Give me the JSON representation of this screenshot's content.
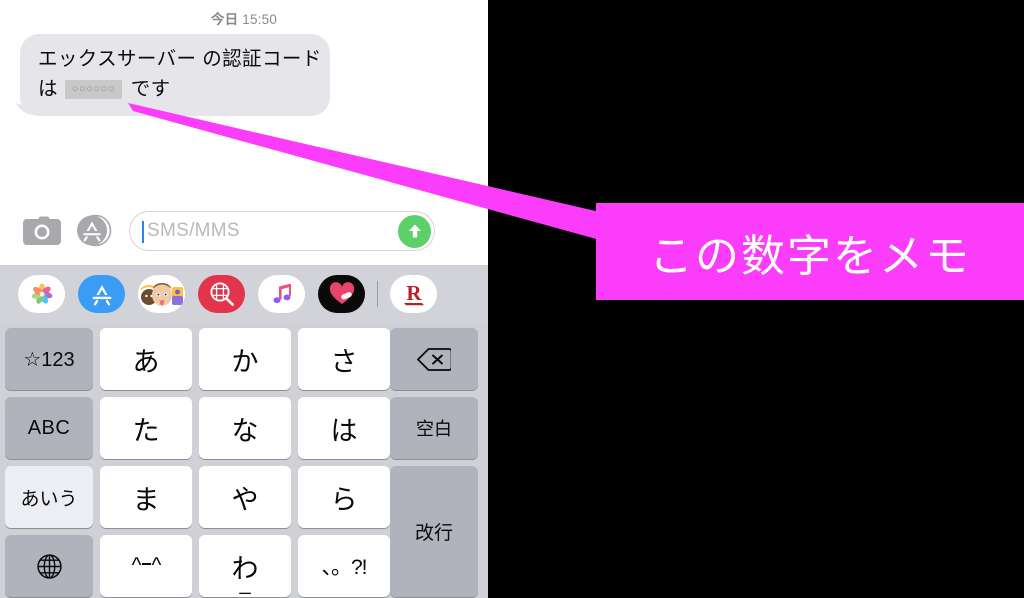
{
  "colors": {
    "annotation_magenta": "#fb3cfb",
    "bubble_gray": "#e5e5ea",
    "send_green": "#5ed06a",
    "keyboard_bg": "#cfd1d6",
    "key_white": "#ffffff",
    "key_func_gray": "#b0b3bb",
    "backdrop_black": "#000000"
  },
  "conversation": {
    "timestamp_day": "今日",
    "timestamp_time": "15:50",
    "message": {
      "line1": "エックスサーバー の認証コード",
      "line2_prefix": "は",
      "redacted_code": "○○○○○○",
      "line2_suffix": "です"
    }
  },
  "input_bar": {
    "camera_icon": "camera-icon",
    "appstore_icon": "app-store-icon",
    "placeholder": "SMS/MMS",
    "value": "",
    "send_icon": "arrow-up-icon"
  },
  "app_drawer": {
    "items": [
      {
        "name": "photos-app-icon",
        "label": "Photos"
      },
      {
        "name": "app-store-app-icon",
        "label": "App Store"
      },
      {
        "name": "memoji-stickers-app-icon",
        "label": "Memoji"
      },
      {
        "name": "images-search-app-icon",
        "label": "#images"
      },
      {
        "name": "music-app-icon",
        "label": "Music"
      },
      {
        "name": "digital-touch-app-icon",
        "label": "Digital Touch"
      },
      {
        "name": "rakuten-app-icon",
        "label": "R"
      }
    ]
  },
  "keyboard": {
    "rows": [
      [
        {
          "label": "☆123",
          "type": "func",
          "name": "key-symbols-123"
        },
        {
          "label": "あ",
          "type": "letter",
          "name": "key-a"
        },
        {
          "label": "か",
          "type": "letter",
          "name": "key-ka"
        },
        {
          "label": "さ",
          "type": "letter",
          "name": "key-sa"
        },
        {
          "label": "⌫",
          "type": "func",
          "name": "key-delete"
        }
      ],
      [
        {
          "label": "ABC",
          "type": "func",
          "name": "key-abc"
        },
        {
          "label": "た",
          "type": "letter",
          "name": "key-ta"
        },
        {
          "label": "な",
          "type": "letter",
          "name": "key-na"
        },
        {
          "label": "は",
          "type": "letter",
          "name": "key-ha"
        },
        {
          "label": "空白",
          "type": "func",
          "name": "key-space"
        }
      ],
      [
        {
          "label": "あいう",
          "type": "active",
          "name": "key-kana-mode"
        },
        {
          "label": "ま",
          "type": "letter",
          "name": "key-ma"
        },
        {
          "label": "や",
          "type": "letter",
          "name": "key-ya"
        },
        {
          "label": "ら",
          "type": "letter",
          "name": "key-ra"
        },
        {
          "label": "改行",
          "type": "func",
          "name": "key-return"
        }
      ],
      [
        {
          "label": "🌐",
          "type": "func",
          "name": "key-globe"
        },
        {
          "label": "^_^",
          "type": "letter",
          "name": "key-kaomoji"
        },
        {
          "label": "わ",
          "type": "letter",
          "name": "key-wa"
        },
        {
          "label": "、。?!",
          "type": "letter",
          "name": "key-punctuation"
        }
      ]
    ],
    "key_labels": {
      "symbols": "☆123",
      "abc": "ABC",
      "kana": "あいう",
      "space": "空白",
      "return": "改行",
      "kaomoji_left": "^",
      "kaomoji_right": "^",
      "wa": "わ",
      "wa_underscore": "_",
      "punctuation": "、。?!",
      "a": "あ",
      "ka": "か",
      "sa": "さ",
      "ta": "た",
      "na": "な",
      "ha": "は",
      "ma": "ま",
      "ya": "や",
      "ra": "ら"
    }
  },
  "annotation": {
    "banner_text": "この数字をメモ",
    "arrow_name": "pointer-arrow"
  }
}
